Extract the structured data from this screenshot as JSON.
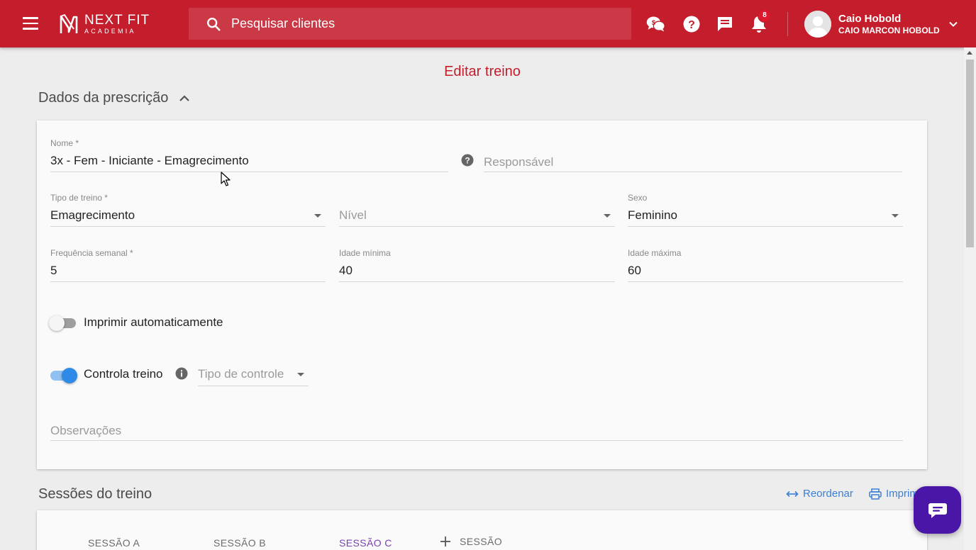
{
  "header": {
    "brand_name": "NEXT FIT",
    "brand_sub": "ACADEMIA",
    "search_placeholder": "Pesquisar clientes",
    "notification_count": "8",
    "user_name": "Caio Hobold",
    "user_full_name": "CAIO MARCON HOBOLD",
    "icons": [
      "menu-icon",
      "search-icon",
      "money-chat-icon",
      "help-icon",
      "message-icon",
      "bell-icon",
      "chevron-down-icon"
    ]
  },
  "page": {
    "title": "Editar treino",
    "prescription_section": "Dados da prescrição",
    "sessions_section": "Sessões do treino"
  },
  "form": {
    "nome_label": "Nome *",
    "nome_value": "3x - Fem - Iniciante - Emagrecimento",
    "responsavel_placeholder": "Responsável",
    "tipo_label": "Tipo de treino *",
    "tipo_value": "Emagrecimento",
    "nivel_placeholder": "Nível",
    "sexo_label": "Sexo",
    "sexo_value": "Feminino",
    "frequencia_label": "Frequência semanal *",
    "frequencia_value": "5",
    "idade_min_label": "Idade mínima",
    "idade_min_value": "40",
    "idade_max_label": "Idade máxima",
    "idade_max_value": "60",
    "imprimir_label": "Imprimir automaticamente",
    "imprimir_on": false,
    "controla_label": "Controla treino",
    "controla_on": true,
    "tipo_controle_placeholder": "Tipo de controle",
    "observacoes_placeholder": "Observações"
  },
  "sessions": {
    "reorder_label": "Reordenar",
    "print_label": "Imprimir",
    "tabs": [
      "SESSÃO A",
      "SESSÃO B",
      "SESSÃO C"
    ],
    "active_tab": "SESSÃO C",
    "add_label": "SESSÃO"
  },
  "colors": {
    "brand_red": "#c41e2d",
    "accent_purple": "#7b3fb0",
    "toggle_blue": "#2e8ae6",
    "link_blue": "#3a7fd5",
    "chat_purple": "#4a16a8"
  }
}
